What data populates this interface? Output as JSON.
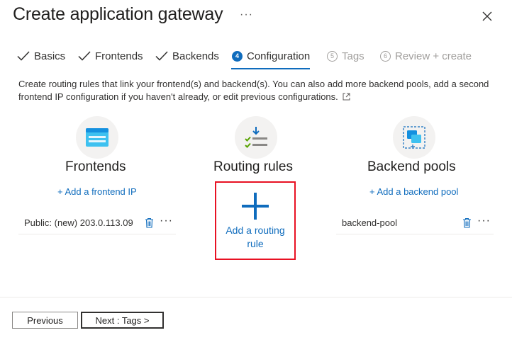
{
  "header": {
    "title": "Create application gateway",
    "more": "···"
  },
  "tabs": [
    {
      "label": "Basics",
      "state": "done"
    },
    {
      "label": "Frontends",
      "state": "done"
    },
    {
      "label": "Backends",
      "state": "done"
    },
    {
      "label": "Configuration",
      "state": "active",
      "number": "4"
    },
    {
      "label": "Tags",
      "state": "disabled",
      "number": "5"
    },
    {
      "label": "Review + create",
      "state": "disabled",
      "number": "6"
    }
  ],
  "description": "Create routing rules that link your frontend(s) and backend(s). You can also add more backend pools, add a second frontend IP configuration if you haven't already, or edit previous configurations.",
  "frontends": {
    "title": "Frontends",
    "add_label": "+ Add a frontend IP",
    "items": [
      {
        "label": "Public: (new) 203.0.113.09",
        "more": "···"
      }
    ]
  },
  "routing": {
    "title": "Routing rules",
    "add_label": "Add a routing rule"
  },
  "backends": {
    "title": "Backend pools",
    "add_label": "+ Add a backend pool",
    "items": [
      {
        "label": "backend-pool",
        "more": "···"
      }
    ]
  },
  "footer": {
    "previous": "Previous",
    "next": "Next : Tags >"
  },
  "colors": {
    "accent": "#0f6cbd",
    "highlight_border": "#e81123"
  }
}
